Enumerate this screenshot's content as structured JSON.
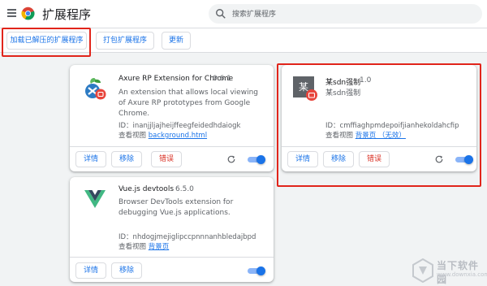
{
  "header": {
    "title": "扩展程序",
    "search_placeholder": "搜索扩展程序"
  },
  "toolbar": {
    "load_unpacked": "加载已解压的扩展程序",
    "pack": "打包扩展程序",
    "update": "更新"
  },
  "extensions": [
    {
      "name": "Axure RP Extension for Chrome",
      "version": "0.6.1",
      "description": "An extension that allows local viewing of Axure RP prototypes from Google Chrome.",
      "id_label": "ID：inanjjljajheijffeegfeidedhdaiogk",
      "views_label": "查看视图",
      "views_link": "background.html",
      "details_label": "详情",
      "remove_label": "移除",
      "error_label": "错误",
      "enabled": true
    },
    {
      "name": "某sdn强制",
      "version": "1.0",
      "description": "某sdn强制",
      "icon_char": "某",
      "id_label": "ID：cmffiaghpmdepoifjianhekoldahcfip",
      "views_label": "查看视图",
      "views_link": "背景页 （无效）",
      "details_label": "详情",
      "remove_label": "移除",
      "error_label": "错误",
      "enabled": true
    },
    {
      "name": "Vue.js devtools",
      "version": "6.5.0",
      "description": "Browser DevTools extension for debugging Vue.js applications.",
      "id_label": "ID：nhdogjmejiglipccpnnnanhbledajbpd",
      "views_label": "查看视图",
      "views_link": "背景页",
      "details_label": "详情",
      "remove_label": "移除",
      "enabled": true
    }
  ],
  "watermark": {
    "text": "当下软件园",
    "sub": "www.downxia.com"
  },
  "colors": {
    "accent": "#1a73e8",
    "error": "#d93025",
    "highlight": "#e1251b"
  }
}
